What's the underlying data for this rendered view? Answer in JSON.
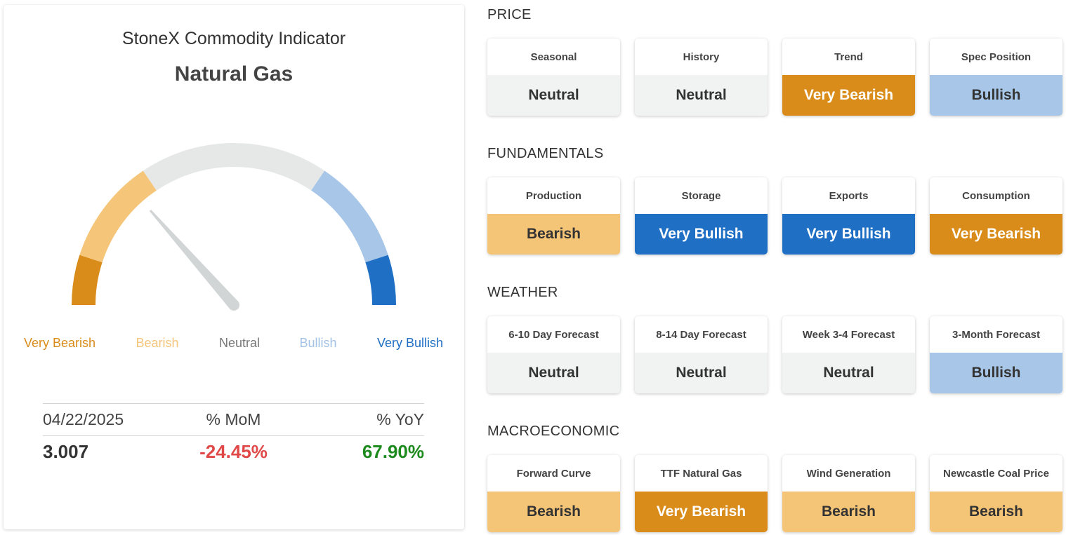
{
  "indicator": {
    "title": "StoneX Commodity Indicator",
    "commodity": "Natural Gas",
    "gauge_reading": 0.27,
    "scale_labels": [
      {
        "label": "Very Bearish",
        "color": "#d98c1a"
      },
      {
        "label": "Bearish",
        "color": "#f5c57a"
      },
      {
        "label": "Neutral",
        "color": "#777777"
      },
      {
        "label": "Bullish",
        "color": "#a3c3e6"
      },
      {
        "label": "Very Bullish",
        "color": "#1f6fc4"
      }
    ],
    "stats": {
      "date": "04/22/2025",
      "mom_label": "% MoM",
      "yoy_label": "% YoY",
      "price": "3.007",
      "mom_value": "-24.45%",
      "yoy_value": "67.90%",
      "mom_color": "#e04848",
      "yoy_color": "#1d8a1d"
    }
  },
  "sentiment_styles": {
    "Neutral": {
      "bg": "#f1f2f2",
      "fg": "#333333"
    },
    "Bearish": {
      "bg": "#f5c577",
      "fg": "#333333"
    },
    "Very Bearish": {
      "bg": "#d98c1a",
      "fg": "#ffffff"
    },
    "Bullish": {
      "bg": "#a7c6e8",
      "fg": "#333333"
    },
    "Very Bullish": {
      "bg": "#1f6fc4",
      "fg": "#ffffff"
    }
  },
  "sections": [
    {
      "title": "PRICE",
      "items": [
        {
          "label": "Seasonal",
          "value": "Neutral"
        },
        {
          "label": "History",
          "value": "Neutral"
        },
        {
          "label": "Trend",
          "value": "Very Bearish"
        },
        {
          "label": "Spec Position",
          "value": "Bullish"
        }
      ]
    },
    {
      "title": "FUNDAMENTALS",
      "items": [
        {
          "label": "Production",
          "value": "Bearish"
        },
        {
          "label": "Storage",
          "value": "Very Bullish"
        },
        {
          "label": "Exports",
          "value": "Very Bullish"
        },
        {
          "label": "Consumption",
          "value": "Very Bearish"
        }
      ]
    },
    {
      "title": "WEATHER",
      "items": [
        {
          "label": "6-10 Day Forecast",
          "value": "Neutral"
        },
        {
          "label": "8-14 Day Forecast",
          "value": "Neutral"
        },
        {
          "label": "Week 3-4 Forecast",
          "value": "Neutral"
        },
        {
          "label": "3-Month Forecast",
          "value": "Bullish"
        }
      ]
    },
    {
      "title": "MACROECONOMIC",
      "items": [
        {
          "label": "Forward Curve",
          "value": "Bearish"
        },
        {
          "label": "TTF Natural Gas",
          "value": "Very Bearish"
        },
        {
          "label": "Wind Generation",
          "value": "Bearish"
        },
        {
          "label": "Newcastle Coal Price",
          "value": "Bearish"
        }
      ]
    }
  ]
}
